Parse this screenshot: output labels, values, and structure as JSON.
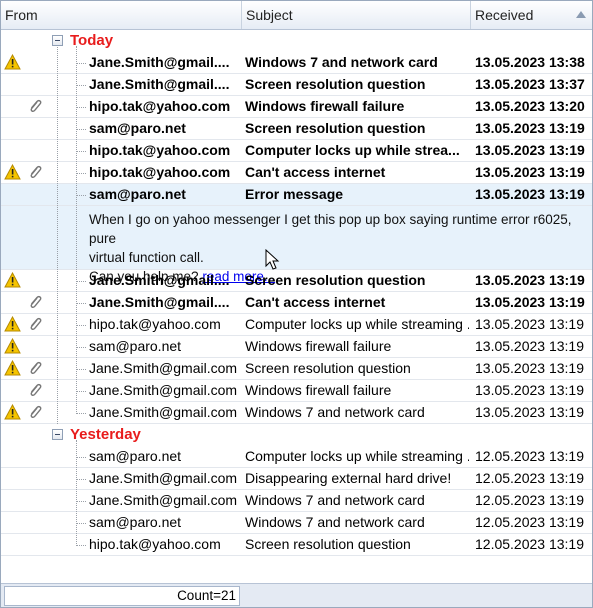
{
  "header": {
    "from_label": "From",
    "subject_label": "Subject",
    "received_label": "Received"
  },
  "groups": [
    {
      "label": "Today",
      "rows": [
        {
          "from": "Jane.Smith@gmail....",
          "subject": "Windows 7 and network card",
          "received": "13.05.2023 13:38",
          "bold": true,
          "warn": true,
          "clip": false
        },
        {
          "from": "Jane.Smith@gmail....",
          "subject": "Screen resolution question",
          "received": "13.05.2023 13:37",
          "bold": true,
          "warn": false,
          "clip": false
        },
        {
          "from": "hipo.tak@yahoo.com",
          "subject": "Windows firewall failure",
          "received": "13.05.2023 13:20",
          "bold": true,
          "warn": false,
          "clip": true
        },
        {
          "from": "sam@paro.net",
          "subject": "Screen resolution question",
          "received": "13.05.2023 13:19",
          "bold": true,
          "warn": false,
          "clip": false
        },
        {
          "from": "hipo.tak@yahoo.com",
          "subject": "Computer locks up while strea...",
          "received": "13.05.2023 13:19",
          "bold": true,
          "warn": false,
          "clip": false
        },
        {
          "from": "hipo.tak@yahoo.com",
          "subject": "Can't access internet",
          "received": "13.05.2023 13:19",
          "bold": true,
          "warn": true,
          "clip": true
        },
        {
          "from": "sam@paro.net",
          "subject": "Error message",
          "received": "13.05.2023 13:19",
          "bold": true,
          "warn": false,
          "clip": false,
          "selected": true
        },
        {
          "from": "Jane.Smith@gmail....",
          "subject": "Screen resolution question",
          "received": "13.05.2023 13:19",
          "bold": true,
          "warn": true,
          "clip": false
        },
        {
          "from": "Jane.Smith@gmail....",
          "subject": "Can't access internet",
          "received": "13.05.2023 13:19",
          "bold": true,
          "warn": false,
          "clip": true
        },
        {
          "from": "hipo.tak@yahoo.com",
          "subject": "Computer locks up while streaming ...",
          "received": "13.05.2023 13:19",
          "bold": false,
          "warn": true,
          "clip": true
        },
        {
          "from": "sam@paro.net",
          "subject": "Windows firewall failure",
          "received": "13.05.2023 13:19",
          "bold": false,
          "warn": true,
          "clip": false
        },
        {
          "from": "Jane.Smith@gmail.com",
          "subject": "Screen resolution question",
          "received": "13.05.2023 13:19",
          "bold": false,
          "warn": true,
          "clip": true
        },
        {
          "from": "Jane.Smith@gmail.com",
          "subject": "Windows firewall failure",
          "received": "13.05.2023 13:19",
          "bold": false,
          "warn": false,
          "clip": true
        },
        {
          "from": "Jane.Smith@gmail.com",
          "subject": "Windows 7 and network card",
          "received": "13.05.2023 13:19",
          "bold": false,
          "warn": true,
          "clip": true
        }
      ]
    },
    {
      "label": "Yesterday",
      "rows": [
        {
          "from": "sam@paro.net",
          "subject": "Computer locks up while streaming ...",
          "received": "12.05.2023 13:19",
          "bold": false,
          "warn": false,
          "clip": false
        },
        {
          "from": "Jane.Smith@gmail.com",
          "subject": "Disappearing external hard drive!",
          "received": "12.05.2023 13:19",
          "bold": false,
          "warn": false,
          "clip": false
        },
        {
          "from": "Jane.Smith@gmail.com",
          "subject": "Windows 7 and network card",
          "received": "12.05.2023 13:19",
          "bold": false,
          "warn": false,
          "clip": false
        },
        {
          "from": "sam@paro.net",
          "subject": "Windows 7 and network card",
          "received": "12.05.2023 13:19",
          "bold": false,
          "warn": false,
          "clip": false
        },
        {
          "from": "hipo.tak@yahoo.com",
          "subject": "Screen resolution question",
          "received": "12.05.2023 13:19",
          "bold": false,
          "warn": false,
          "clip": false
        }
      ]
    }
  ],
  "preview": {
    "line1": "When I go on yahoo messenger I get this pop up box saying runtime error r6025, pure",
    "line2": "virtual function call.",
    "line3": "Can you help me?",
    "link": "read more..."
  },
  "footer": {
    "count": "Count=21"
  },
  "colors": {
    "group_label": "#e81c1c",
    "selection": "#e7f2fb",
    "link": "#0000ee"
  }
}
